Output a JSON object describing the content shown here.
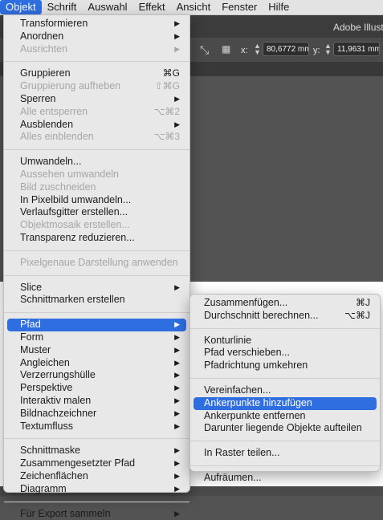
{
  "menubar": {
    "items": [
      "Objekt",
      "Schrift",
      "Auswahl",
      "Effekt",
      "Ansicht",
      "Fenster",
      "Hilfe"
    ]
  },
  "app": {
    "title": "Adobe Illustr",
    "x_label": "x:",
    "x_value": "80,6772 mm",
    "y_label": "y:",
    "y_value": "11,9631 mm"
  },
  "objekt_menu": {
    "items": [
      {
        "label": "Transformieren",
        "arrow": "▶"
      },
      {
        "label": "Anordnen",
        "arrow": "▶"
      },
      {
        "label": "Ausrichten",
        "arrow": "▶"
      },
      {
        "label": "Gruppieren",
        "shortcut": "⌘G"
      },
      {
        "label": "Gruppierung aufheben",
        "shortcut": "⇧⌘G"
      },
      {
        "label": "Sperren",
        "arrow": "▶"
      },
      {
        "label": "Alle entsperren",
        "shortcut": "⌥⌘2"
      },
      {
        "label": "Ausblenden",
        "arrow": "▶"
      },
      {
        "label": "Alles einblenden",
        "shortcut": "⌥⌘3"
      },
      {
        "label": "Umwandeln..."
      },
      {
        "label": "Aussehen umwandeln"
      },
      {
        "label": "Bild zuschneiden"
      },
      {
        "label": "In Pixelbild umwandeln..."
      },
      {
        "label": "Verlaufsgitter erstellen..."
      },
      {
        "label": "Objektmosaik erstellen..."
      },
      {
        "label": "Transparenz reduzieren..."
      },
      {
        "label": "Pixelgenaue Darstellung anwenden"
      },
      {
        "label": "Slice",
        "arrow": "▶"
      },
      {
        "label": "Schnittmarken erstellen"
      },
      {
        "label": "Pfad",
        "arrow": "▶"
      },
      {
        "label": "Form",
        "arrow": "▶"
      },
      {
        "label": "Muster",
        "arrow": "▶"
      },
      {
        "label": "Angleichen",
        "arrow": "▶"
      },
      {
        "label": "Verzerrungshülle",
        "arrow": "▶"
      },
      {
        "label": "Perspektive",
        "arrow": "▶"
      },
      {
        "label": "Interaktiv malen",
        "arrow": "▶"
      },
      {
        "label": "Bildnachzeichner",
        "arrow": "▶"
      },
      {
        "label": "Textumfluss",
        "arrow": "▶"
      },
      {
        "label": "Schnittmaske",
        "arrow": "▶"
      },
      {
        "label": "Zusammengesetzter Pfad",
        "arrow": "▶"
      },
      {
        "label": "Zeichenflächen",
        "arrow": "▶"
      },
      {
        "label": "Diagramm",
        "arrow": "▶"
      },
      {
        "label": "Für Export sammeln",
        "arrow": "▶"
      }
    ]
  },
  "pfad_submenu": {
    "items": [
      {
        "label": "Zusammenfügen...",
        "shortcut": "⌘J"
      },
      {
        "label": "Durchschnitt berechnen...",
        "shortcut": "⌥⌘J"
      },
      {
        "label": "Konturlinie"
      },
      {
        "label": "Pfad verschieben..."
      },
      {
        "label": "Pfadrichtung umkehren"
      },
      {
        "label": "Vereinfachen..."
      },
      {
        "label": "Ankerpunkte hinzufügen"
      },
      {
        "label": "Ankerpunkte entfernen"
      },
      {
        "label": "Darunter liegende Objekte aufteilen"
      },
      {
        "label": "In Raster teilen..."
      },
      {
        "label": "Aufräumen..."
      }
    ]
  },
  "colors": {
    "highlight": "#2f6ee0",
    "menu_bg": "#e9e8e9",
    "disabled_text": "#a6a6a6"
  }
}
